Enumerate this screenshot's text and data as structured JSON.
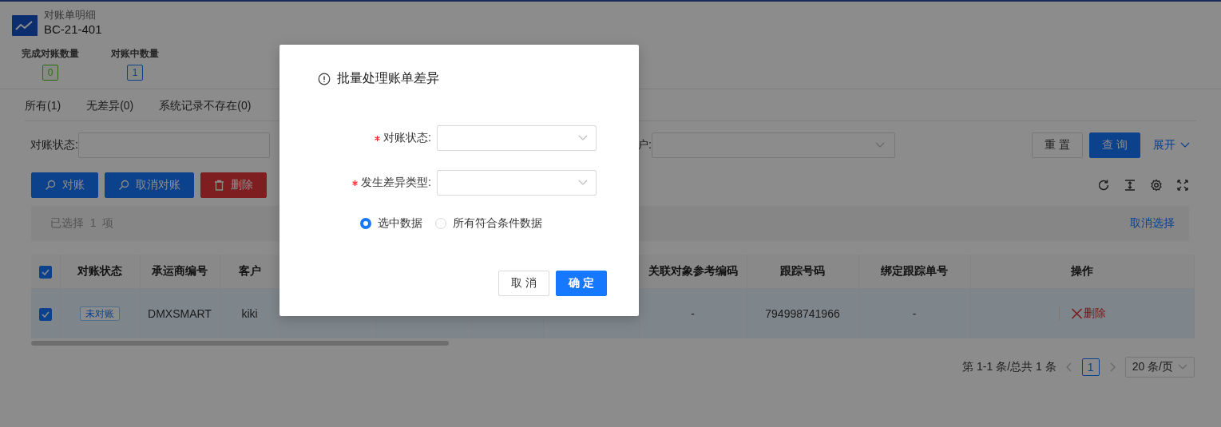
{
  "header": {
    "subtitle": "对账单明细",
    "title": "BC-21-401"
  },
  "stats": [
    {
      "label": "完成对账数量",
      "value": "0",
      "color": "#2d6c0e"
    },
    {
      "label": "对账中数量",
      "value": "1",
      "color": "#0c418c"
    }
  ],
  "tabs": [
    {
      "label": "所有(1)",
      "selected": false
    },
    {
      "label": "无差异(0)",
      "selected": false
    },
    {
      "label": "系统记录不存在(0)",
      "selected": false
    }
  ],
  "filters": [
    {
      "label": "对账状态:"
    },
    {
      "label": "户:"
    }
  ],
  "filter_buttons": [
    {
      "label": "重 置",
      "kind": "default"
    },
    {
      "label": "查 询",
      "kind": "primary"
    }
  ],
  "expand": "展开",
  "actions": [
    {
      "label": "对账",
      "kind": "search"
    },
    {
      "label": "取消对账",
      "kind": "search"
    },
    {
      "label": "删除",
      "kind": "delete"
    }
  ],
  "selection": {
    "text": "已选择  1  项",
    "clear": "取消选择"
  },
  "table": {
    "all_selected": true,
    "columns": [
      {
        "header": "对账状态"
      },
      {
        "header": "承运商编号"
      },
      {
        "header": "客户"
      },
      {
        "header": "关联对象参考编码"
      },
      {
        "header": "跟踪号码"
      },
      {
        "header": "绑定跟踪单号"
      },
      {
        "header": "操作"
      }
    ],
    "rows": [
      {
        "selected": true,
        "cells": [
          "未对账",
          "DMXSMART",
          "kiki",
          "-",
          "794998741966",
          "-",
          "删除"
        ]
      }
    ]
  },
  "pagination": {
    "summary": "第 1-1 条/总共 1 条",
    "pages": [
      {
        "label": "1",
        "selected": true
      }
    ],
    "page_size": "20 条/页"
  },
  "dialog": {
    "title": "批量处理账单差异",
    "fields": [
      {
        "label": "对账状态:",
        "required": true
      },
      {
        "label": "发生差异类型:",
        "required": true
      }
    ],
    "scope": [
      {
        "label": "选中数据",
        "selected": true
      },
      {
        "label": "所有符合条件数据",
        "selected": false
      }
    ],
    "buttons": [
      {
        "label": "取 消",
        "kind": "default"
      },
      {
        "label": "确 定",
        "kind": "primary"
      }
    ]
  }
}
